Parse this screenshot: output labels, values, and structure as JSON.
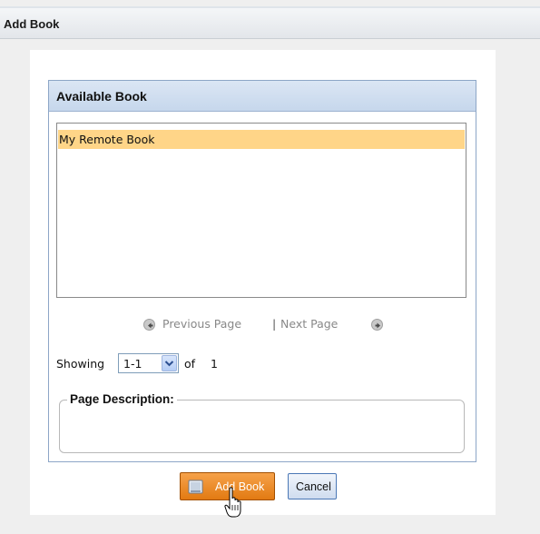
{
  "dialog": {
    "title": "Add Book"
  },
  "available": {
    "header": "Available Book",
    "items": [
      {
        "label": "My Remote Book",
        "selected": true
      }
    ],
    "selected_color": "#ffd588"
  },
  "pager": {
    "prev_label": "Previous Page",
    "separator": "|",
    "next_label": "Next Page",
    "prev_icon": "arrow-left-circle-icon",
    "next_icon": "arrow-right-circle-icon"
  },
  "showing": {
    "label": "Showing",
    "range_value": "1-1",
    "of_label": "of",
    "total": "1"
  },
  "description": {
    "legend": "Page Description:"
  },
  "buttons": {
    "add_label": "Add Book",
    "add_icon": "book-icon",
    "cancel_label": "Cancel",
    "add_color": "#e8841f"
  }
}
